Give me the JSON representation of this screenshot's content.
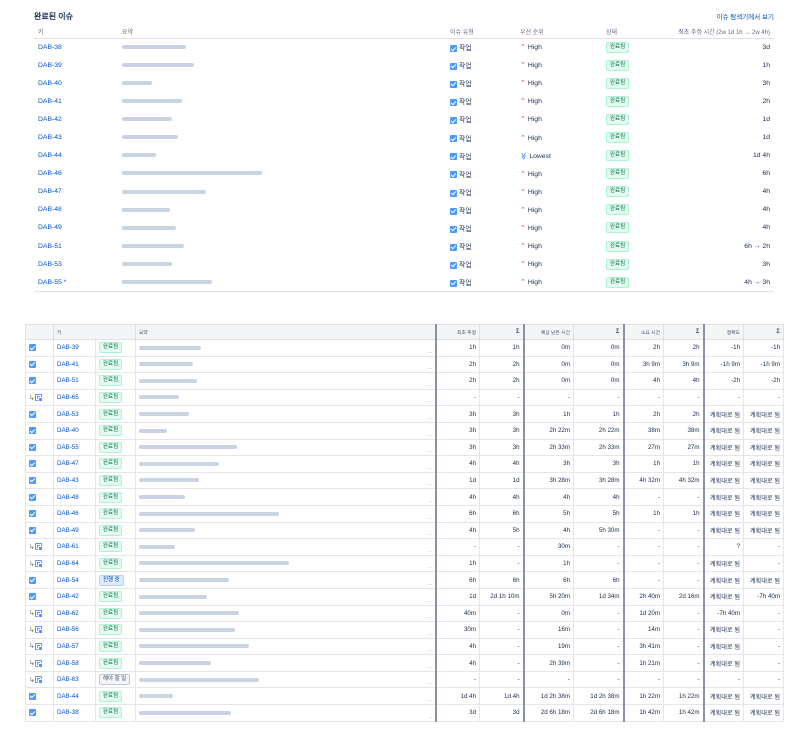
{
  "top": {
    "title": "완료된 이슈",
    "navigator_link": "이슈 탐색기에서 보기",
    "headers": {
      "key": "키",
      "summary": "요약",
      "type": "이슈 유형",
      "priority": "우선 순위",
      "status": "상태",
      "estimate": "최초 추정 시간 (2w 1d 1h → 2w 4h)"
    },
    "rows": [
      {
        "key": "DAB-38",
        "type": "작업",
        "priority": "High",
        "status": "완료됨",
        "estimate": "3d",
        "w": 64
      },
      {
        "key": "DAB-39",
        "type": "작업",
        "priority": "High",
        "status": "완료됨",
        "estimate": "1h",
        "w": 72
      },
      {
        "key": "DAB-40",
        "type": "작업",
        "priority": "High",
        "status": "완료됨",
        "estimate": "3h",
        "w": 30
      },
      {
        "key": "DAB-41",
        "type": "작업",
        "priority": "High",
        "status": "완료됨",
        "estimate": "2h",
        "w": 60
      },
      {
        "key": "DAB-42",
        "type": "작업",
        "priority": "High",
        "status": "완료됨",
        "estimate": "1d",
        "w": 50
      },
      {
        "key": "DAB-43",
        "type": "작업",
        "priority": "High",
        "status": "완료됨",
        "estimate": "1d",
        "w": 56
      },
      {
        "key": "DAB-44",
        "type": "작업",
        "priority": "Lowest",
        "status": "완료됨",
        "estimate": "1d 4h",
        "w": 34
      },
      {
        "key": "DAB-46",
        "type": "작업",
        "priority": "High",
        "status": "완료됨",
        "estimate": "6h",
        "w": 140
      },
      {
        "key": "DAB-47",
        "type": "작업",
        "priority": "High",
        "status": "완료됨",
        "estimate": "4h",
        "w": 84
      },
      {
        "key": "DAB-48",
        "type": "작업",
        "priority": "High",
        "status": "완료됨",
        "estimate": "4h",
        "w": 48
      },
      {
        "key": "DAB-49",
        "type": "작업",
        "priority": "High",
        "status": "완료됨",
        "estimate": "4h",
        "w": 54
      },
      {
        "key": "DAB-51",
        "type": "작업",
        "priority": "High",
        "status": "완료됨",
        "estimate": "6h → 2h",
        "w": 62
      },
      {
        "key": "DAB-53",
        "type": "작업",
        "priority": "High",
        "status": "완료됨",
        "estimate": "3h",
        "w": 50
      },
      {
        "key": "DAB-55 *",
        "type": "작업",
        "priority": "High",
        "status": "완료됨",
        "estimate": "4h → 3h",
        "w": 90
      }
    ]
  },
  "bottom": {
    "headers": {
      "key": "키",
      "summary": "요약",
      "orig": "최초 추정",
      "remaining": "예상 남은 시간",
      "spent": "소요 시간",
      "accuracy": "정확도",
      "sigma": "Σ"
    },
    "rows": [
      {
        "icon": "check",
        "key": "DAB-39",
        "status": "완료됨",
        "sc": "done",
        "w": 62,
        "o": "1h",
        "os": "1h",
        "r": "0m",
        "rs": "0m",
        "s": "2h",
        "ss": "2h",
        "a": "-1h",
        "as": "-1h"
      },
      {
        "icon": "check",
        "key": "DAB-41",
        "status": "완료됨",
        "sc": "done",
        "w": 54,
        "o": "2h",
        "os": "2h",
        "r": "0m",
        "rs": "0m",
        "s": "3h 9m",
        "ss": "3h 9m",
        "a": "-1h 9m",
        "as": "-1h 9m"
      },
      {
        "icon": "check",
        "key": "DAB-51",
        "status": "완료됨",
        "sc": "done",
        "w": 58,
        "o": "2h",
        "os": "2h",
        "r": "0m",
        "rs": "0m",
        "s": "4h",
        "ss": "4h",
        "a": "-2h",
        "as": "-2h"
      },
      {
        "icon": "sub",
        "key": "DAB-65",
        "status": "완료됨",
        "sc": "done",
        "w": 40,
        "o": "-",
        "os": "-",
        "r": "-",
        "rs": "-",
        "s": "-",
        "ss": "-",
        "a": "-",
        "as": "-"
      },
      {
        "icon": "check",
        "key": "DAB-53",
        "status": "완료됨",
        "sc": "done",
        "w": 50,
        "o": "3h",
        "os": "3h",
        "r": "1h",
        "rs": "1h",
        "s": "2h",
        "ss": "2h",
        "a": "계획대로 됨",
        "as": "계획대로 됨"
      },
      {
        "icon": "check",
        "key": "DAB-40",
        "status": "완료됨",
        "sc": "done",
        "w": 28,
        "o": "3h",
        "os": "3h",
        "r": "2h 22m",
        "rs": "2h 22m",
        "s": "38m",
        "ss": "38m",
        "a": "계획대로 됨",
        "as": "계획대로 됨"
      },
      {
        "icon": "check",
        "key": "DAB-55",
        "status": "완료됨",
        "sc": "done",
        "w": 98,
        "o": "3h",
        "os": "3h",
        "r": "2h 33m",
        "rs": "2h 33m",
        "s": "27m",
        "ss": "27m",
        "a": "계획대로 됨",
        "as": "계획대로 됨"
      },
      {
        "icon": "check",
        "key": "DAB-47",
        "status": "완료됨",
        "sc": "done",
        "w": 80,
        "o": "4h",
        "os": "4h",
        "r": "3h",
        "rs": "3h",
        "s": "1h",
        "ss": "1h",
        "a": "계획대로 됨",
        "as": "계획대로 됨"
      },
      {
        "icon": "check",
        "key": "DAB-43",
        "status": "완료됨",
        "sc": "done",
        "w": 60,
        "o": "1d",
        "os": "1d",
        "r": "3h 28m",
        "rs": "3h 28m",
        "s": "4h 32m",
        "ss": "4h 32m",
        "a": "계획대로 됨",
        "as": "계획대로 됨"
      },
      {
        "icon": "check",
        "key": "DAB-48",
        "status": "완료됨",
        "sc": "done",
        "w": 46,
        "o": "4h",
        "os": "4h",
        "r": "4h",
        "rs": "4h",
        "s": "-",
        "ss": "-",
        "a": "계획대로 됨",
        "as": "계획대로 됨"
      },
      {
        "icon": "check",
        "key": "DAB-46",
        "status": "완료됨",
        "sc": "done",
        "w": 140,
        "o": "6h",
        "os": "6h",
        "r": "5h",
        "rs": "5h",
        "s": "1h",
        "ss": "1h",
        "a": "계획대로 됨",
        "as": "계획대로 됨"
      },
      {
        "icon": "check",
        "key": "DAB-49",
        "status": "완료됨",
        "sc": "done",
        "w": 56,
        "o": "4h",
        "os": "5h",
        "r": "4h",
        "rs": "5h 30m",
        "s": "-",
        "ss": "-",
        "a": "계획대로 됨",
        "as": "계획대로 됨"
      },
      {
        "icon": "sub",
        "key": "DAB-61",
        "status": "완료됨",
        "sc": "done",
        "w": 36,
        "o": "-",
        "os": "-",
        "r": "30m",
        "rs": "-",
        "s": "-",
        "ss": "-",
        "a": "?",
        "as": "-"
      },
      {
        "icon": "sub",
        "key": "DAB-64",
        "status": "완료됨",
        "sc": "done",
        "w": 150,
        "o": "1h",
        "os": "-",
        "r": "1h",
        "rs": "-",
        "s": "-",
        "ss": "-",
        "a": "계획대로 됨",
        "as": "-"
      },
      {
        "icon": "check",
        "key": "DAB-54",
        "status": "진행 중",
        "sc": "prog",
        "w": 90,
        "o": "6h",
        "os": "6h",
        "r": "6h",
        "rs": "6h",
        "s": "-",
        "ss": "-",
        "a": "계획대로 됨",
        "as": "계획대로 됨"
      },
      {
        "icon": "check",
        "key": "DAB-42",
        "status": "완료됨",
        "sc": "done",
        "w": 68,
        "o": "1d",
        "os": "2d 1h 10m",
        "r": "5h 20m",
        "rs": "1d 34m",
        "s": "2h 40m",
        "ss": "2d 16m",
        "a": "계획대로 됨",
        "as": "-7h 40m"
      },
      {
        "icon": "sub",
        "key": "DAB-62",
        "status": "완료됨",
        "sc": "done",
        "w": 100,
        "o": "40m",
        "os": "-",
        "r": "0m",
        "rs": "-",
        "s": "1d 20m",
        "ss": "-",
        "a": "-7h 40m",
        "as": "-"
      },
      {
        "icon": "sub",
        "key": "DAB-56",
        "status": "완료됨",
        "sc": "done",
        "w": 96,
        "o": "30m",
        "os": "-",
        "r": "16m",
        "rs": "-",
        "s": "14m",
        "ss": "-",
        "a": "계획대로 됨",
        "as": "-"
      },
      {
        "icon": "sub",
        "key": "DAB-57",
        "status": "완료됨",
        "sc": "done",
        "w": 110,
        "o": "4h",
        "os": "-",
        "r": "19m",
        "rs": "-",
        "s": "3h 41m",
        "ss": "-",
        "a": "계획대로 됨",
        "as": "-"
      },
      {
        "icon": "sub",
        "key": "DAB-58",
        "status": "완료됨",
        "sc": "done",
        "w": 72,
        "o": "4h",
        "os": "-",
        "r": "2h 39m",
        "rs": "-",
        "s": "1h 21m",
        "ss": "-",
        "a": "계획대로 됨",
        "as": "-"
      },
      {
        "icon": "sub",
        "key": "DAB-63",
        "status": "해야 할 일",
        "sc": "todo",
        "w": 120,
        "o": "-",
        "os": "-",
        "r": "-",
        "rs": "-",
        "s": "-",
        "ss": "-",
        "a": "-",
        "as": "-"
      },
      {
        "icon": "check",
        "key": "DAB-44",
        "status": "완료됨",
        "sc": "done",
        "w": 34,
        "o": "1d 4h",
        "os": "1d 4h",
        "r": "1d 2h 38m",
        "rs": "1d 2h 38m",
        "s": "1h 22m",
        "ss": "1h 22m",
        "a": "계획대로 됨",
        "as": "계획대로 됨"
      },
      {
        "icon": "check",
        "key": "DAB-38",
        "status": "완료됨",
        "sc": "done",
        "w": 92,
        "o": "3d",
        "os": "3d",
        "r": "2d 6h 18m",
        "rs": "2d 6h 18m",
        "s": "1h 42m",
        "ss": "1h 42m",
        "a": "계획대로 됨",
        "as": "계획대로 됨"
      }
    ]
  }
}
